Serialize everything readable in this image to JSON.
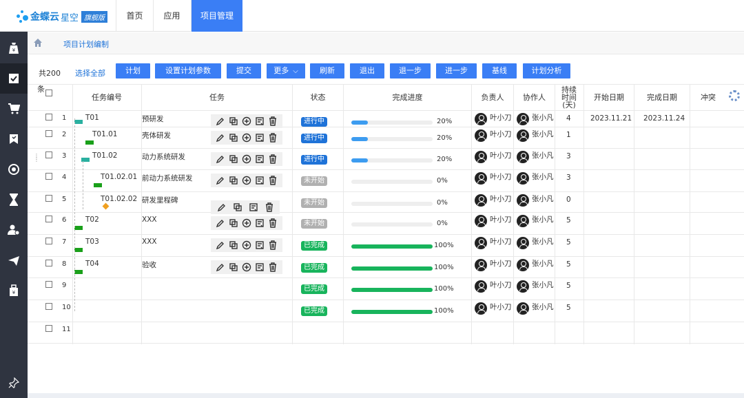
{
  "app": {
    "logo_text": "金蝶云",
    "logo_sub": "星空",
    "logo_badge": "旗舰版"
  },
  "nav": {
    "tabs": [
      {
        "label": "首页"
      },
      {
        "label": "应用"
      },
      {
        "label": "项目管理",
        "active": true
      }
    ]
  },
  "sidebar": {
    "items": [
      {
        "icon": "bag-yen-icon"
      },
      {
        "icon": "checklist-icon",
        "active": true
      },
      {
        "icon": "cart-icon"
      },
      {
        "icon": "bookmark-icon"
      },
      {
        "icon": "target-icon"
      },
      {
        "icon": "hourglass-icon"
      },
      {
        "icon": "user-settings-icon"
      },
      {
        "icon": "airplane-icon"
      },
      {
        "icon": "gift-bag-icon"
      },
      {
        "icon": "pin-icon"
      }
    ]
  },
  "breadcrumb": {
    "current": "项目计划编制"
  },
  "toolbar": {
    "count": "共200",
    "select_all": "选择全部",
    "buttons": {
      "plan": "计划",
      "set_params": "设置计划参数",
      "submit": "提交",
      "more": "更多",
      "refresh": "刷新",
      "exit": "退出",
      "step_back": "退一步",
      "step_forward": "进一步",
      "baseline": "基线",
      "analysis": "计划分析"
    }
  },
  "table": {
    "headers": {
      "seq": "条",
      "code": "任务编号",
      "task": "任务",
      "status": "状态",
      "progress": "完成进度",
      "owner": "负责人",
      "collab": "协作人",
      "duration": "持续时间(天)",
      "start": "开始日期",
      "end": "完成日期",
      "conflict": "冲突"
    },
    "rows": [
      {
        "num": "1",
        "code": "T01",
        "name": "预研发",
        "status": "进行中",
        "status_type": "blue",
        "progress": 0.2,
        "progress_text": "20%",
        "owner": "叶小刀",
        "collab": "张小凡",
        "duration": "4",
        "start": "2023.11.21",
        "end": "2023.11.24"
      },
      {
        "num": "2",
        "code": "T01.01",
        "name": "壳体研发",
        "status": "进行中",
        "status_type": "blue",
        "progress": 0.2,
        "progress_text": "20%",
        "owner": "叶小刀",
        "collab": "张小凡",
        "duration": "1",
        "start": "",
        "end": ""
      },
      {
        "num": "3",
        "code": "T01.02",
        "name": "动力系统研发",
        "status": "进行中",
        "status_type": "blue",
        "progress": 0.2,
        "progress_text": "20%",
        "owner": "叶小刀",
        "collab": "张小凡",
        "duration": "3",
        "start": "",
        "end": ""
      },
      {
        "num": "4",
        "code": "T01.02.01",
        "name": "前动力系统研发",
        "status": "未开始",
        "status_type": "gray",
        "progress": 0,
        "progress_text": "0%",
        "owner": "叶小刀",
        "collab": "张小凡",
        "duration": "3",
        "start": "",
        "end": ""
      },
      {
        "num": "5",
        "code": "T01.02.02",
        "name": "研发里程碑",
        "status": "未开始",
        "status_type": "gray",
        "progress": 0,
        "progress_text": "0%",
        "owner": "叶小刀",
        "collab": "张小凡",
        "duration": "0",
        "start": "",
        "end": ""
      },
      {
        "num": "6",
        "code": "T02",
        "name": "XXX",
        "status": "未开始",
        "status_type": "gray",
        "progress": 0,
        "progress_text": "0%",
        "owner": "叶小刀",
        "collab": "张小凡",
        "duration": "5",
        "start": "",
        "end": ""
      },
      {
        "num": "7",
        "code": "T03",
        "name": "XXX",
        "status": "已完成",
        "status_type": "green",
        "progress": 1.0,
        "progress_text": "100%",
        "owner": "叶小刀",
        "collab": "张小凡",
        "duration": "5",
        "start": "",
        "end": ""
      },
      {
        "num": "8",
        "code": "T04",
        "name": "验收",
        "status": "已完成",
        "status_type": "green",
        "progress": 1.0,
        "progress_text": "100%",
        "owner": "叶小刀",
        "collab": "张小凡",
        "duration": "5",
        "start": "",
        "end": ""
      },
      {
        "num": "9",
        "code": "",
        "name": "",
        "status": "已完成",
        "status_type": "green",
        "progress": 1.0,
        "progress_text": "100%",
        "owner": "叶小刀",
        "collab": "张小凡",
        "duration": "5",
        "start": "",
        "end": ""
      },
      {
        "num": "10",
        "code": "",
        "name": "",
        "status": "已完成",
        "status_type": "green",
        "progress": 1.0,
        "progress_text": "100%",
        "owner": "叶小刀",
        "collab": "张小凡",
        "duration": "5",
        "start": "",
        "end": ""
      },
      {
        "num": "11",
        "code": "",
        "name": "",
        "status": "",
        "status_type": "",
        "progress": null,
        "progress_text": "",
        "owner": "",
        "collab": "",
        "duration": "",
        "start": "",
        "end": ""
      }
    ]
  },
  "colors": {
    "accent": "#3a7ef5",
    "progress_blue": "#3d9cf0",
    "progress_green": "#18b45c",
    "sidebar_bg": "#2f3440"
  }
}
